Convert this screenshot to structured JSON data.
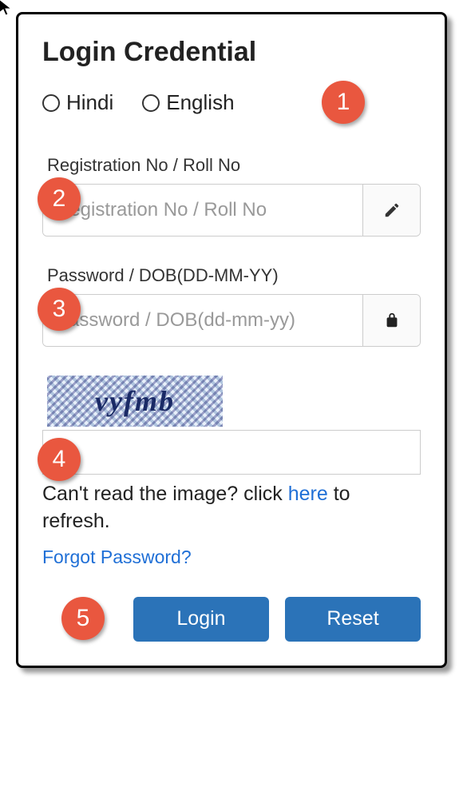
{
  "title": "Login Credential",
  "language": {
    "hindi_label": "Hindi",
    "english_label": "English"
  },
  "registration": {
    "label": "Registration No / Roll No",
    "placeholder": "Registration No / Roll No"
  },
  "password": {
    "label": "Password / DOB(DD-MM-YY)",
    "placeholder": "Password / DOB(dd-mm-yy)"
  },
  "captcha": {
    "text": "vyfmb",
    "refresh_prefix": "Can't read the image? click ",
    "refresh_link": "here",
    "refresh_suffix": " to refresh."
  },
  "forgot_label": "Forgot Password?",
  "buttons": {
    "login": "Login",
    "reset": "Reset"
  },
  "markers": {
    "m1": "1",
    "m2": "2",
    "m3": "3",
    "m4": "4",
    "m5": "5"
  }
}
